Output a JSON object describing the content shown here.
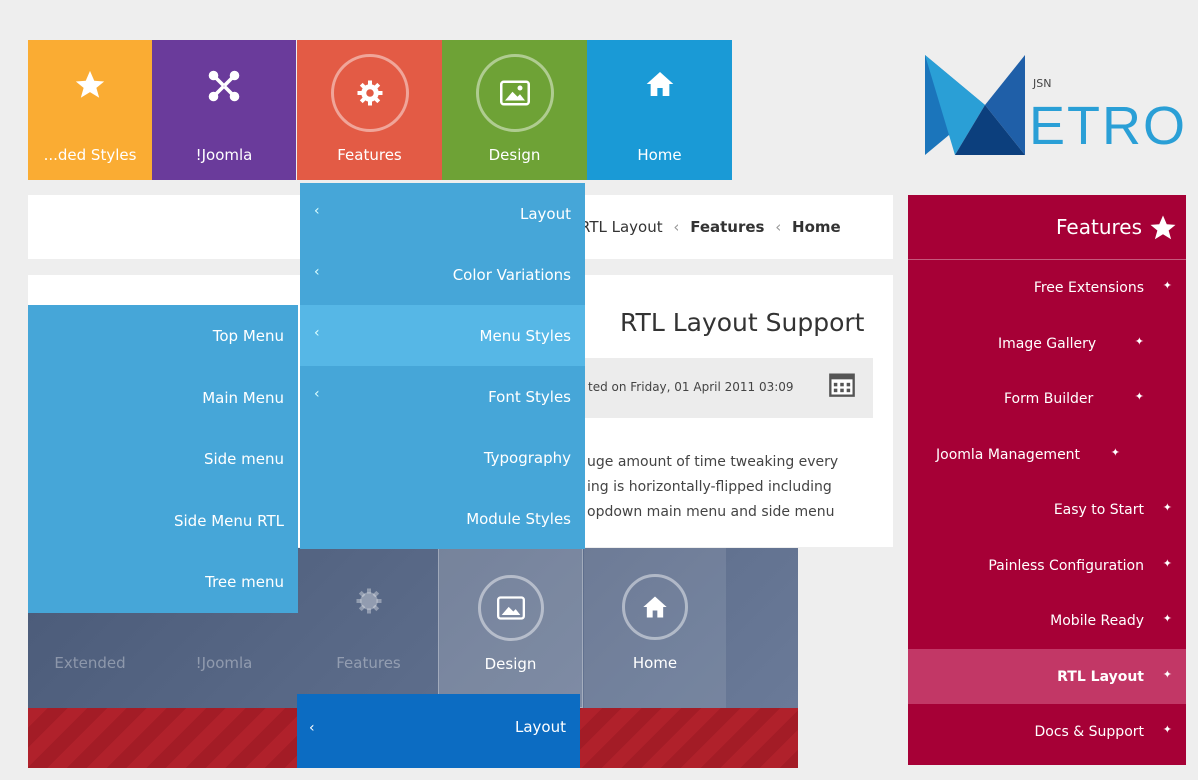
{
  "top_tiles": [
    {
      "label": "...ded Styles",
      "icon": "star-icon",
      "color": "#faac33"
    },
    {
      "label": "!Joomla",
      "icon": "joomla-logo-icon",
      "color": "#6a3b9b"
    },
    {
      "label": "Features",
      "icon": "gear-icon",
      "color": "#e35b45"
    },
    {
      "label": "Design",
      "icon": "image-icon",
      "color": "#6ea236"
    },
    {
      "label": "Home",
      "icon": "home-icon",
      "color": "#1a9ad6"
    }
  ],
  "logo": {
    "small": "JSN",
    "big": "ETRO"
  },
  "breadcrumb": {
    "items": [
      "RTL Layout",
      "Features",
      "Home"
    ]
  },
  "features_dropdown": {
    "items": [
      {
        "label": "Layout"
      },
      {
        "label": "Color Variations"
      },
      {
        "label": "Menu Styles"
      },
      {
        "label": "Font Styles"
      },
      {
        "label": "Typography"
      },
      {
        "label": "Module Styles"
      }
    ]
  },
  "menu_styles_submenu": {
    "items": [
      {
        "label": "Top Menu"
      },
      {
        "label": "Main Menu"
      },
      {
        "label": "Side menu"
      },
      {
        "label": "Side Menu RTL"
      },
      {
        "label": "Tree menu"
      }
    ]
  },
  "article": {
    "title": "RTL Layout Support",
    "meta": "ted on Friday, 01 April 2011 03:09",
    "body_lines": [
      "uge amount of time tweaking every",
      "ing is horizontally-flipped including",
      "opdown main menu and side menu"
    ]
  },
  "sidebar": {
    "title": "Features",
    "items": [
      {
        "label": "Free Extensions"
      },
      {
        "label": "Image Gallery"
      },
      {
        "label": "Form Builder"
      },
      {
        "label": "Joomla Management"
      },
      {
        "label": "Easy to Start"
      },
      {
        "label": "Painless Configuration"
      },
      {
        "label": "Mobile Ready"
      },
      {
        "label": "RTL Layout"
      },
      {
        "label": "Docs & Support"
      }
    ]
  },
  "bottom_tiles": [
    {
      "label": "Extended"
    },
    {
      "label": "!Joomla"
    },
    {
      "label": "Features"
    },
    {
      "label": "Design"
    },
    {
      "label": "Home"
    }
  ],
  "bottom_layout": {
    "label": "Layout"
  }
}
